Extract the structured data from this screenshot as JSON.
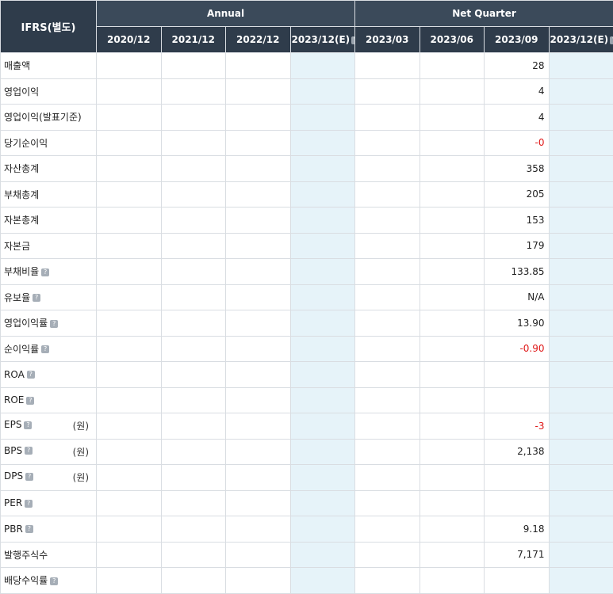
{
  "header": {
    "corner": "IFRS(별도)",
    "group_annual": "Annual",
    "group_quarter": "Net Quarter",
    "annual_periods": [
      "2020/12",
      "2021/12",
      "2022/12",
      "2023/12(E)"
    ],
    "quarter_periods": [
      "2023/03",
      "2023/06",
      "2023/09",
      "2023/12(E)"
    ],
    "help_glyph": "?"
  },
  "rows": [
    {
      "label": "매출액",
      "help": false,
      "unit": "",
      "values": [
        "",
        "",
        "",
        "",
        "",
        "",
        "28",
        ""
      ]
    },
    {
      "label": "영업이익",
      "help": false,
      "unit": "",
      "values": [
        "",
        "",
        "",
        "",
        "",
        "",
        "4",
        ""
      ]
    },
    {
      "label": "영업이익(발표기준)",
      "help": false,
      "unit": "",
      "values": [
        "",
        "",
        "",
        "",
        "",
        "",
        "4",
        ""
      ]
    },
    {
      "label": "당기순이익",
      "help": false,
      "unit": "",
      "values": [
        "",
        "",
        "",
        "",
        "",
        "",
        "-0",
        ""
      ]
    },
    {
      "label": "자산총계",
      "help": false,
      "unit": "",
      "values": [
        "",
        "",
        "",
        "",
        "",
        "",
        "358",
        ""
      ]
    },
    {
      "label": "부채총계",
      "help": false,
      "unit": "",
      "values": [
        "",
        "",
        "",
        "",
        "",
        "",
        "205",
        ""
      ]
    },
    {
      "label": "자본총계",
      "help": false,
      "unit": "",
      "values": [
        "",
        "",
        "",
        "",
        "",
        "",
        "153",
        ""
      ]
    },
    {
      "label": "자본금",
      "help": false,
      "unit": "",
      "values": [
        "",
        "",
        "",
        "",
        "",
        "",
        "179",
        ""
      ]
    },
    {
      "label": "부채비율",
      "help": true,
      "unit": "",
      "values": [
        "",
        "",
        "",
        "",
        "",
        "",
        "133.85",
        ""
      ]
    },
    {
      "label": "유보율",
      "help": true,
      "unit": "",
      "values": [
        "",
        "",
        "",
        "",
        "",
        "",
        "N/A",
        ""
      ]
    },
    {
      "label": "영업이익률",
      "help": true,
      "unit": "",
      "values": [
        "",
        "",
        "",
        "",
        "",
        "",
        "13.90",
        ""
      ]
    },
    {
      "label": "순이익률",
      "help": true,
      "unit": "",
      "values": [
        "",
        "",
        "",
        "",
        "",
        "",
        "-0.90",
        ""
      ]
    },
    {
      "label": "ROA",
      "help": true,
      "unit": "",
      "values": [
        "",
        "",
        "",
        "",
        "",
        "",
        "",
        ""
      ]
    },
    {
      "label": "ROE",
      "help": true,
      "unit": "",
      "values": [
        "",
        "",
        "",
        "",
        "",
        "",
        "",
        ""
      ]
    },
    {
      "label": "EPS",
      "help": true,
      "unit": "(원)",
      "values": [
        "",
        "",
        "",
        "",
        "",
        "",
        "-3",
        ""
      ]
    },
    {
      "label": "BPS",
      "help": true,
      "unit": "(원)",
      "values": [
        "",
        "",
        "",
        "",
        "",
        "",
        "2,138",
        ""
      ]
    },
    {
      "label": "DPS",
      "help": true,
      "unit": "(원)",
      "values": [
        "",
        "",
        "",
        "",
        "",
        "",
        "",
        ""
      ]
    },
    {
      "label": "PER",
      "help": true,
      "unit": "",
      "values": [
        "",
        "",
        "",
        "",
        "",
        "",
        "",
        ""
      ]
    },
    {
      "label": "PBR",
      "help": true,
      "unit": "",
      "values": [
        "",
        "",
        "",
        "",
        "",
        "",
        "9.18",
        ""
      ]
    },
    {
      "label": "발행주식수",
      "help": false,
      "unit": "",
      "values": [
        "",
        "",
        "",
        "",
        "",
        "",
        "7,171",
        ""
      ]
    },
    {
      "label": "배당수익률",
      "help": true,
      "unit": "",
      "values": [
        "",
        "",
        "",
        "",
        "",
        "",
        "",
        ""
      ]
    }
  ],
  "colors": {
    "header_bg": "#3b4a5a",
    "estimate_bg": "#e6f3f9",
    "negative": "#e01a1a"
  }
}
